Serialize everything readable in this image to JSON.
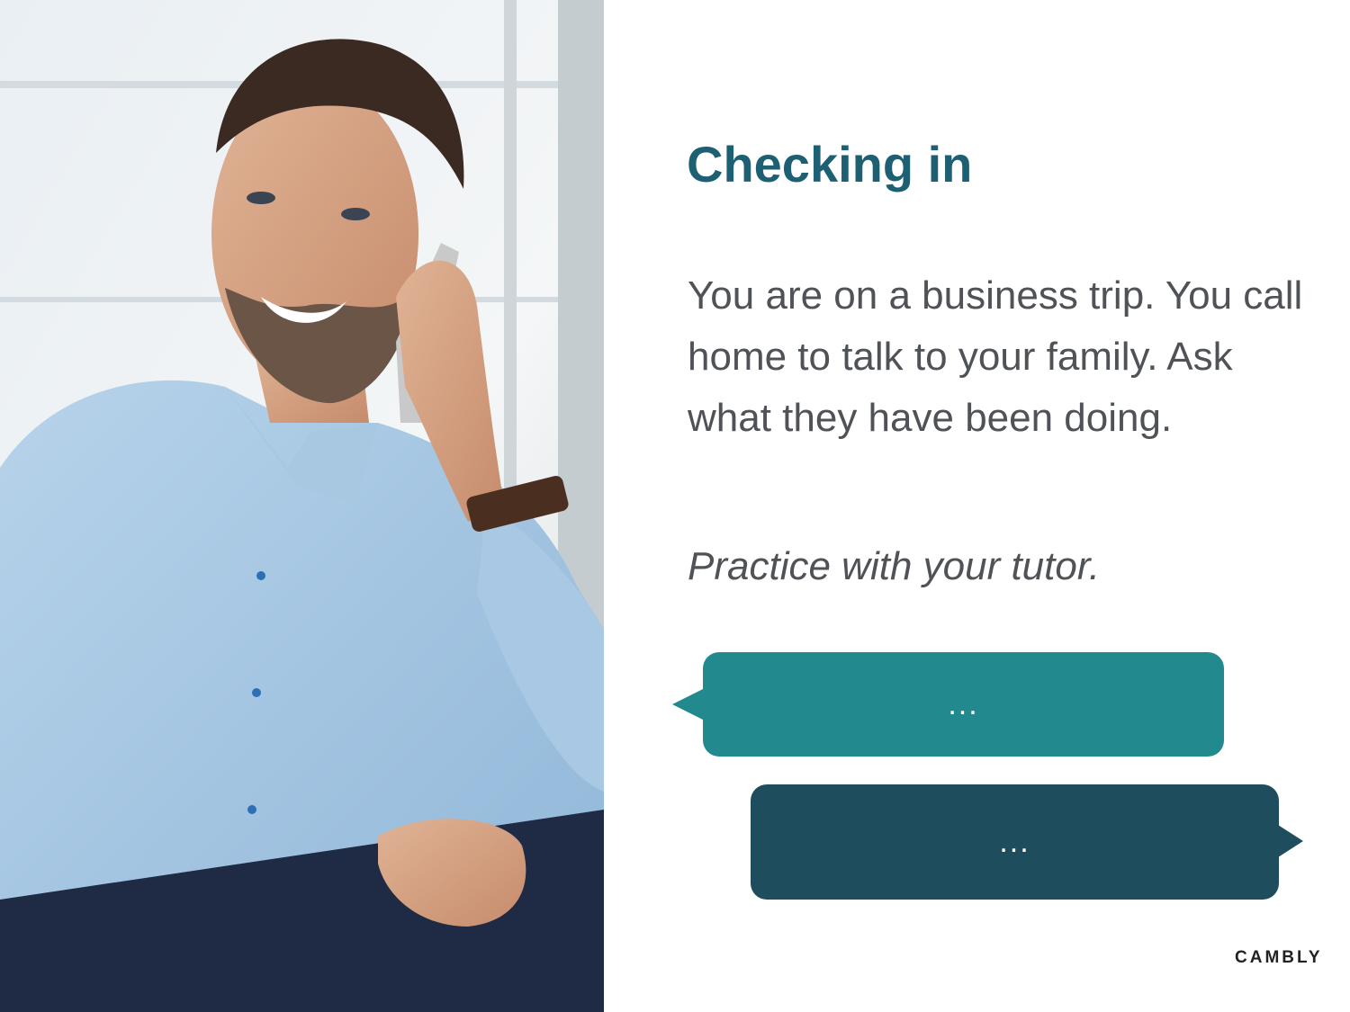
{
  "slide": {
    "title": "Checking in",
    "body": "You are on a business trip. You call home to talk to your family. Ask what they have been doing.",
    "instruction": "Practice with your tutor.",
    "bubbles": [
      {
        "text": "...",
        "color": "#228a8f"
      },
      {
        "text": "...",
        "color": "#1e4e5e"
      }
    ],
    "logo": "CAMBLY"
  },
  "colors": {
    "title": "#1d5f73",
    "body_text": "#4f5256"
  },
  "image": {
    "subject": "man-on-phone-photo"
  }
}
